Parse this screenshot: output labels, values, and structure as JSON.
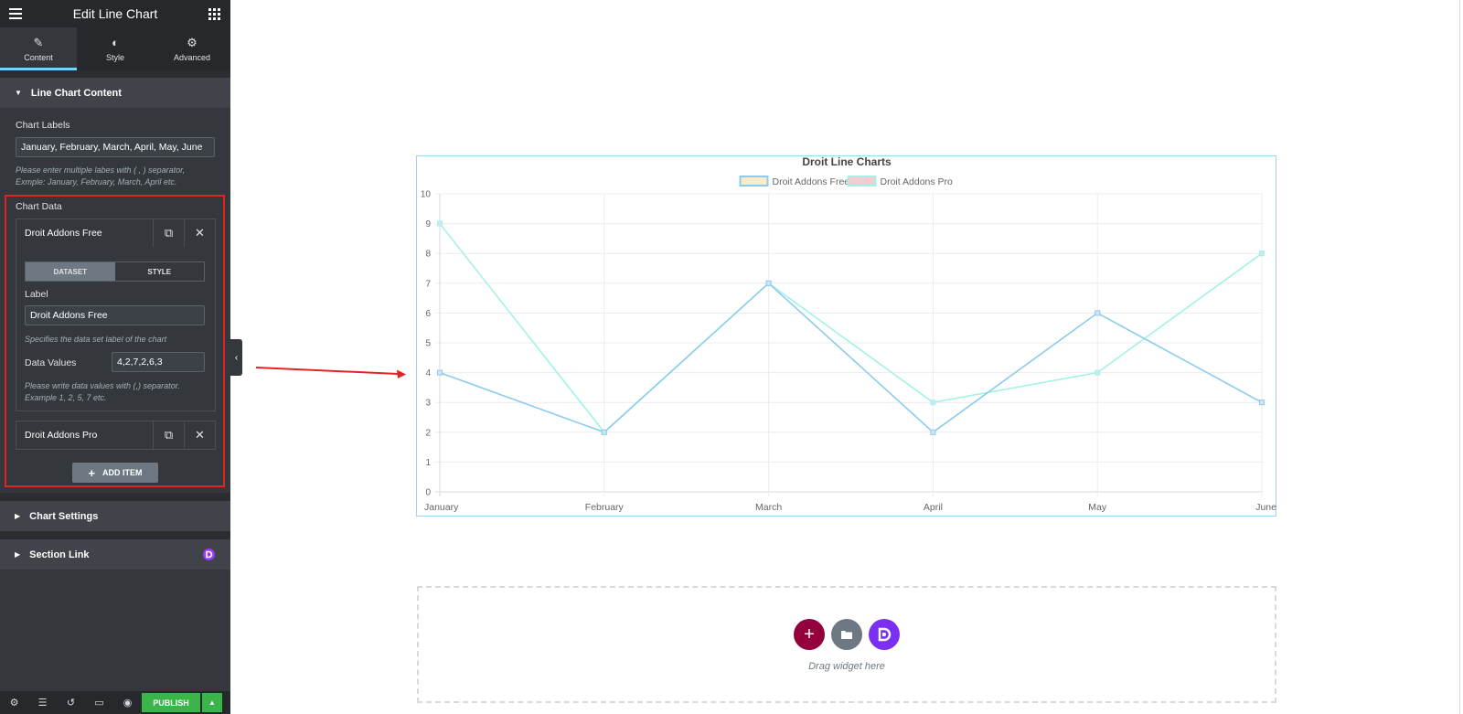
{
  "panel": {
    "title": "Edit Line Chart",
    "tabs": [
      {
        "label": "Content",
        "icon": "pencil-icon"
      },
      {
        "label": "Style",
        "icon": "half-circle-icon"
      },
      {
        "label": "Advanced",
        "icon": "gear-icon"
      }
    ],
    "active_tab": "Content",
    "section_line_chart_content": "Line Chart Content",
    "chart_labels_label": "Chart Labels",
    "chart_labels_value": "January, February, March, April, May, June",
    "chart_labels_desc_1": "Please enter multiple labes with ( , ) separator,",
    "chart_labels_desc_2": "Exmple: January, February, March, April etc.",
    "chart_data_label": "Chart Data",
    "repeater_items": [
      {
        "label": "Droit Addons Free"
      },
      {
        "label": "Droit Addons Pro"
      }
    ],
    "segment": {
      "dataset": "DATASET",
      "style": "STYLE"
    },
    "dataset_label_label": "Label",
    "dataset_label_value": "Droit Addons Free",
    "dataset_label_desc": "Specifies the data set label of the chart",
    "data_values_label": "Data Values",
    "data_values_value": "4,2,7,2,6,3",
    "data_values_desc_1": "Please write data values with (,) separator.",
    "data_values_desc_2": "Example 1, 2, 5, 7 etc.",
    "add_item": "ADD ITEM",
    "section_chart_settings": "Chart Settings",
    "section_section_link": "Section Link",
    "publish": "PUBLISH",
    "highlight_color": "#e32323",
    "accent_color": "#71d7f7",
    "publish_color": "#39b54a"
  },
  "canvas": {
    "drag_text": "Drag widget here",
    "buttons": [
      {
        "name": "add-section-button",
        "color": "#93003c",
        "icon": "plus-icon"
      },
      {
        "name": "add-template-button",
        "color": "#6d7882",
        "icon": "folder-icon"
      },
      {
        "name": "droit-library-button",
        "color": "#7b2ff0",
        "icon": "droit-logo-icon"
      }
    ]
  },
  "chart_data": {
    "type": "line",
    "title": "Droit Line Charts",
    "categories": [
      "January",
      "February",
      "March",
      "April",
      "May",
      "June"
    ],
    "series": [
      {
        "name": "Droit Addons Free",
        "values": [
          4,
          2,
          7,
          2,
          6,
          3
        ],
        "color": "#8ccbee",
        "legend_fill": "#fbecc6"
      },
      {
        "name": "Droit Addons Pro",
        "values": [
          9,
          2,
          7,
          3,
          4,
          8
        ],
        "color": "#a4f2e6",
        "legend_fill": "#f9c9d1"
      }
    ],
    "ylim": [
      0,
      10
    ],
    "yticks": [
      0,
      1,
      2,
      3,
      4,
      5,
      6,
      7,
      8,
      9,
      10
    ],
    "grid": true,
    "legend": "top-center",
    "xlabel": "",
    "ylabel": ""
  }
}
